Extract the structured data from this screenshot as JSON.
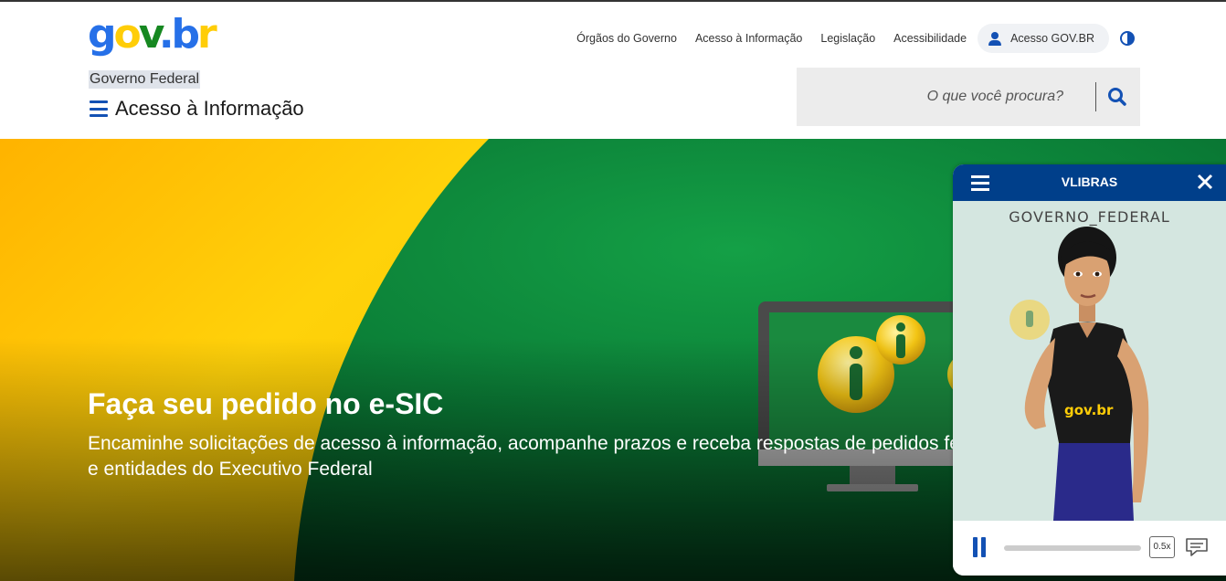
{
  "header": {
    "logo": {
      "g": "g",
      "o": "o",
      "v": "v",
      "dot": ".",
      "b": "b",
      "r": "r"
    },
    "gov_federal": "Governo Federal",
    "site_title": "Acesso à Informação",
    "links": [
      "Órgãos do Governo",
      "Acesso à Informação",
      "Legislação",
      "Acessibilidade"
    ],
    "login_label": "Acesso GOV.BR",
    "search_placeholder": "O que você procura?",
    "colors": {
      "primary": "#1351b4",
      "blue": "#2670e8",
      "yellow": "#ffcd07",
      "green": "#168821"
    }
  },
  "hero": {
    "title": "Faça seu pedido no e-SIC",
    "subtitle": "Encaminhe solicitações de acesso à informação, acompanhe prazos e receba respostas de pedidos feitos a órgãos e entidades do Executivo Federal"
  },
  "vlibras": {
    "title": "VLIBRAS",
    "caption": "GOVERNO_FEDERAL",
    "shirt_logo": "gov.br",
    "speed": "0.5x"
  }
}
